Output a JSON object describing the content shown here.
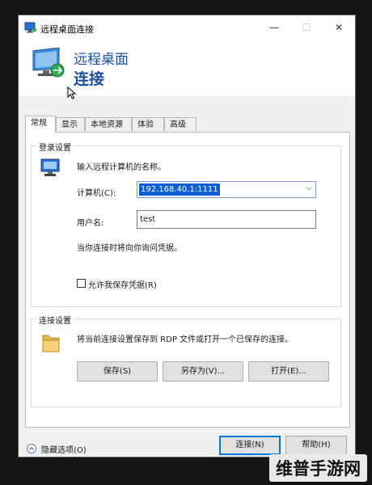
{
  "window": {
    "title": "远程桌面连接",
    "banner_line1": "远程桌面",
    "banner_line2": "连接",
    "controls": {
      "minimize": "—",
      "maximize": "☐",
      "close": "✕"
    }
  },
  "tabs": [
    {
      "label": "常规",
      "active": true
    },
    {
      "label": "显示",
      "active": false
    },
    {
      "label": "本地资源",
      "active": false
    },
    {
      "label": "体验",
      "active": false
    },
    {
      "label": "高级",
      "active": false
    }
  ],
  "login_group": {
    "label": "登录设置",
    "instruction": "输入远程计算机的名称。",
    "computer_label": "计算机(C):",
    "computer_value": "192.168.40.1:1111",
    "username_label": "用户名:",
    "username_value": "test",
    "hint": "当你连接时将向你询问凭据。",
    "save_credentials_label": "允许我保存凭据(R)",
    "save_credentials_checked": false
  },
  "connection_group": {
    "label": "连接设置",
    "description": "将当前连接设置保存到 RDP 文件或打开一个已保存的连接。",
    "save_button": "保存(S)",
    "save_as_button": "另存为(V)...",
    "open_button": "打开(E)..."
  },
  "footer": {
    "hide_options": "隐藏选项(O)",
    "connect_button": "连接(N)",
    "help_button": "帮助(H)"
  },
  "watermark": "维普手游网",
  "colors": {
    "accent": "#1b4f9c",
    "selection": "#0a5fd6",
    "focus": "#0078d7"
  }
}
